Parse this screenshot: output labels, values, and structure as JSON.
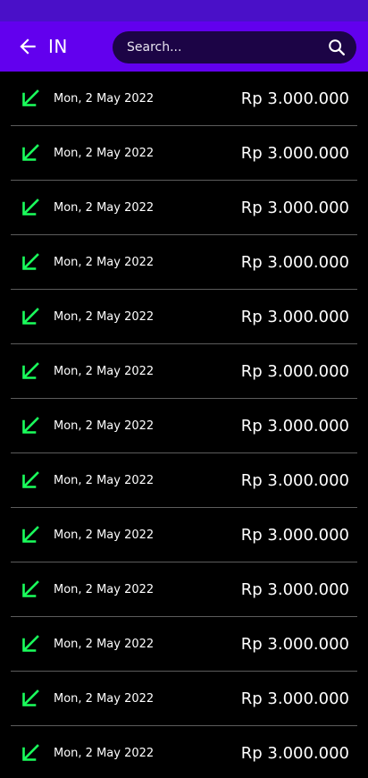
{
  "app_bar": {
    "title": "IN",
    "back_icon": "arrow-back-icon",
    "search": {
      "placeholder": "Search...",
      "value": "",
      "icon": "search-icon"
    }
  },
  "colors": {
    "status_bar": "#4a10c8",
    "app_bar": "#6200ee",
    "search_bg": "#1c0446",
    "income_arrow": "#1aff5c",
    "background": "#000000"
  },
  "transactions": [
    {
      "icon": "income-arrow-icon",
      "date": "Mon, 2 May 2022",
      "amount": "Rp 3.000.000"
    },
    {
      "icon": "income-arrow-icon",
      "date": "Mon, 2 May 2022",
      "amount": "Rp 3.000.000"
    },
    {
      "icon": "income-arrow-icon",
      "date": "Mon, 2 May 2022",
      "amount": "Rp 3.000.000"
    },
    {
      "icon": "income-arrow-icon",
      "date": "Mon, 2 May 2022",
      "amount": "Rp 3.000.000"
    },
    {
      "icon": "income-arrow-icon",
      "date": "Mon, 2 May 2022",
      "amount": "Rp 3.000.000"
    },
    {
      "icon": "income-arrow-icon",
      "date": "Mon, 2 May 2022",
      "amount": "Rp 3.000.000"
    },
    {
      "icon": "income-arrow-icon",
      "date": "Mon, 2 May 2022",
      "amount": "Rp 3.000.000"
    },
    {
      "icon": "income-arrow-icon",
      "date": "Mon, 2 May 2022",
      "amount": "Rp 3.000.000"
    },
    {
      "icon": "income-arrow-icon",
      "date": "Mon, 2 May 2022",
      "amount": "Rp 3.000.000"
    },
    {
      "icon": "income-arrow-icon",
      "date": "Mon, 2 May 2022",
      "amount": "Rp 3.000.000"
    },
    {
      "icon": "income-arrow-icon",
      "date": "Mon, 2 May 2022",
      "amount": "Rp 3.000.000"
    },
    {
      "icon": "income-arrow-icon",
      "date": "Mon, 2 May 2022",
      "amount": "Rp 3.000.000"
    },
    {
      "icon": "income-arrow-icon",
      "date": "Mon, 2 May 2022",
      "amount": "Rp 3.000.000"
    }
  ]
}
